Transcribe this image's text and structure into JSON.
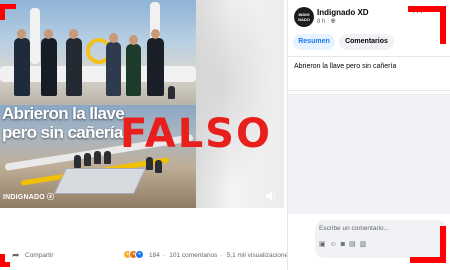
{
  "media": {
    "headline_line1": "Abrieron la llave",
    "headline_line2": "pero sin cañería",
    "stamp": "FALSO",
    "watermark": "INDIGNADO ⓧ"
  },
  "actions": {
    "share_label": "Compartir",
    "reaction_count": "184",
    "comments": "101 comentarios",
    "views": "5,1 mil visualizaciones",
    "reactions": [
      "wow-reaction",
      "angry-reaction",
      "like-reaction"
    ]
  },
  "post": {
    "avatar_text": "INDIG NADO",
    "page_name": "Indignado XD",
    "time": "8 h",
    "audience_icon": "globe-icon",
    "tabs": [
      {
        "label": "Resumen",
        "active": true
      },
      {
        "label": "Comentarios",
        "active": false
      }
    ],
    "caption": "Abrieron la llave pero sin cañería"
  },
  "comment": {
    "placeholder": "Escribe un comentario..."
  },
  "colors": {
    "stamp": "#e8201d",
    "corner_marks": "#ff0000",
    "tab_active_bg": "#e7f3ff",
    "tab_active_text": "#1877f2"
  }
}
